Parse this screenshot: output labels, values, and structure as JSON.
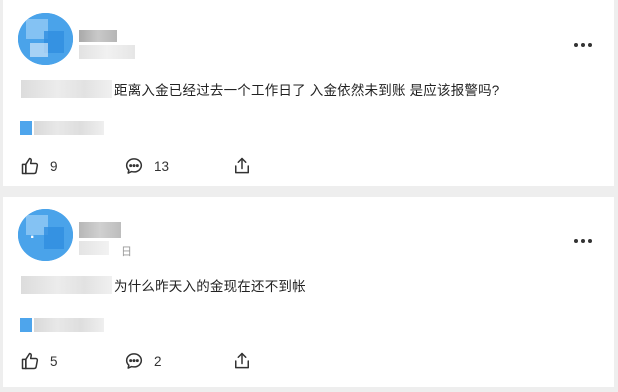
{
  "posts": [
    {
      "text": "距离入金已经过去一个工作日了 入金依然未到账 是应该报警吗?",
      "likes": "9",
      "comments": "13"
    },
    {
      "meta_suffix": "日",
      "text": "为什么昨天入的金现在还不到帐",
      "likes": "5",
      "comments": "2"
    }
  ],
  "icons": {
    "like": "thumbs-up-icon",
    "comment": "comment-icon",
    "share": "share-icon",
    "more": "more-dots-icon"
  },
  "colors": {
    "page_background": "#eeeeee",
    "card_background": "#ffffff",
    "avatar_blue": "#3d9be6",
    "tag_blue": "#4ea5ec"
  }
}
